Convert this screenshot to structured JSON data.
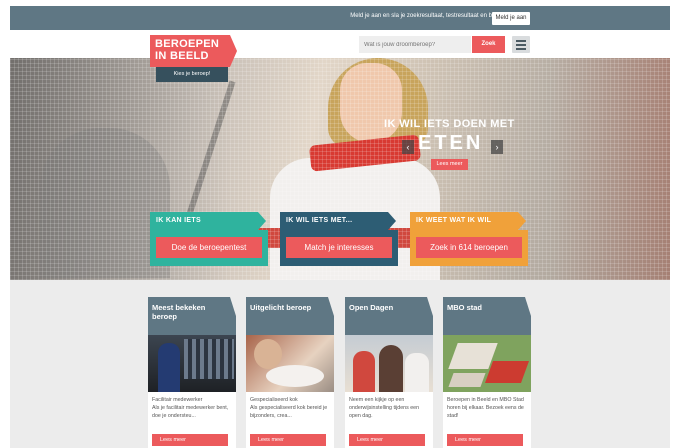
{
  "topbar": {
    "text": "Meld je aan en sla je zoekresultaat, testresultaat en beroepen op.",
    "button": "Meld je aan"
  },
  "logo": {
    "line1": "BEROEPEN",
    "line2": "IN BEELD",
    "tagline": "Kies je beroep!"
  },
  "search": {
    "placeholder": "Wat is jouw droomberoep?",
    "button": "Zoek",
    "menu_icon": "hamburger-icon"
  },
  "hero": {
    "headline": "IK WIL IETS DOEN MET",
    "word": "ETEN",
    "more": "Lees meer",
    "prev_arrow": "‹",
    "next_arrow": "›"
  },
  "ctas": [
    {
      "title": "IK KAN IETS",
      "button": "Doe de beroepentest",
      "color": "#2fb39e"
    },
    {
      "title": "IK WIL IETS MET...",
      "button": "Match je interesses",
      "color": "#2d5d74"
    },
    {
      "title": "IK WEET WAT IK WIL",
      "button": "Zoek in 614 beroepen",
      "color": "#f0a13a"
    }
  ],
  "cards": [
    {
      "title": "Meest bekeken beroep",
      "text": "Facilitair medewerker\nAls je facilitair medewerker bent, doe je ondersteu...",
      "link": "Lees meer"
    },
    {
      "title": "Uitgelicht beroep",
      "text": "Gespecialiseerd kok\nAls gespecialiseerd kok bereid je bijzonders, crea...",
      "link": "Lees meer"
    },
    {
      "title": "Open Dagen",
      "text": "Neem een kijkje op een onderwijsinstelling tijdens een open dag.",
      "link": "Lees meer"
    },
    {
      "title": "MBO stad",
      "text": "Beroepen in Beeld en MBO Stad horen bij elkaar. Bezoek eens de stad!",
      "link": "Lees meer"
    }
  ],
  "colors": {
    "accent": "#ec5a5c",
    "topbar": "#5f7784",
    "teal": "#2fb39e",
    "navy": "#2d5d74",
    "orange": "#f0a13a"
  }
}
